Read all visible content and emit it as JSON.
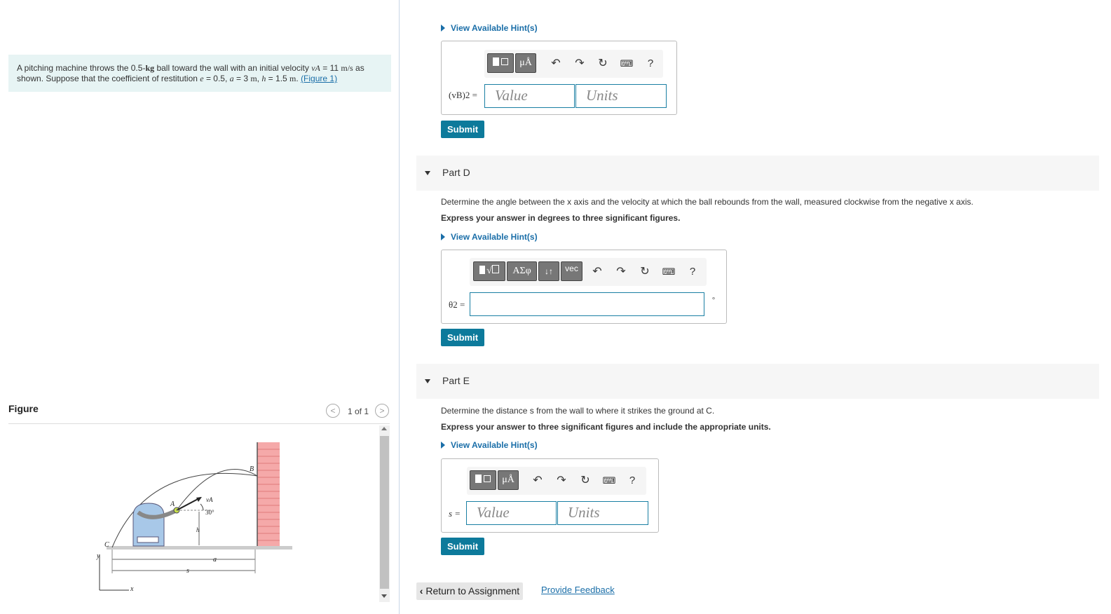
{
  "problem": {
    "text_before": "A pitching machine throws the 0.5-",
    "mass_unit": "kg",
    "text_mid": " ball toward the wall with an initial velocity ",
    "v_symbol": "vA",
    "v_eq": " = 11 ",
    "v_unit": "m/s",
    "text_as": " as",
    "line2_a": "shown. Suppose that the coefficient of restitution ",
    "e_symbol": "e",
    "e_eq": " = 0.5, ",
    "a_symbol": "a",
    "a_eq": " = 3 ",
    "a_unit": "m",
    "h_sep": ", ",
    "h_symbol": "h",
    "h_eq": " = 1.5 ",
    "h_unit": "m",
    "period": ". ",
    "figure_link": "(Figure 1)"
  },
  "figure": {
    "heading": "Figure",
    "pager": "1 of 1",
    "prev_glyph": "<",
    "next_glyph": ">",
    "labels": {
      "B": "B",
      "A": "A",
      "vA": "vA",
      "angle": "30°",
      "h": "h",
      "C": "C",
      "y": "y",
      "x": "x",
      "a": "a",
      "s": "s"
    },
    "colors": {
      "machine": "#a8c8e8",
      "wall": "#f0a0a0",
      "ball": "#c8e04a"
    }
  },
  "part_c": {
    "hint": "View Available Hint(s)",
    "label": "(vB)2 =",
    "value_placeholder": "Value",
    "units_placeholder": "Units",
    "submit": "Submit",
    "toolbar": {
      "mu": "μÅ",
      "help": "?"
    }
  },
  "part_d": {
    "title": "Part D",
    "description": "Determine the angle between the x axis and the velocity at which the ball rebounds from the wall, measured clockwise from the negative x axis.",
    "instruction": "Express your answer in degrees to three significant figures.",
    "hint": "View Available Hint(s)",
    "label": "θ2 =",
    "unit": "°",
    "submit": "Submit",
    "toolbar": {
      "greek": "ΑΣφ",
      "arrows": "↓↑",
      "vec": "vec",
      "help": "?"
    }
  },
  "part_e": {
    "title": "Part E",
    "description": "Determine the distance s from the wall to where it strikes the ground at C.",
    "instruction": "Express your answer to three significant figures and include the appropriate units.",
    "hint": "View Available Hint(s)",
    "label": "s =",
    "value_placeholder": "Value",
    "units_placeholder": "Units",
    "submit": "Submit",
    "toolbar": {
      "mu": "μÅ",
      "help": "?"
    }
  },
  "footer": {
    "return": "Return to Assignment",
    "feedback": "Provide Feedback"
  },
  "icons": {
    "undo": "undo-icon",
    "redo": "redo-icon",
    "reset": "reset-icon",
    "keyboard": "keyboard-icon"
  },
  "colors": {
    "accent": "#0d7a9b",
    "link": "#1a6ea8",
    "problem_bg": "#e7f4f4"
  }
}
